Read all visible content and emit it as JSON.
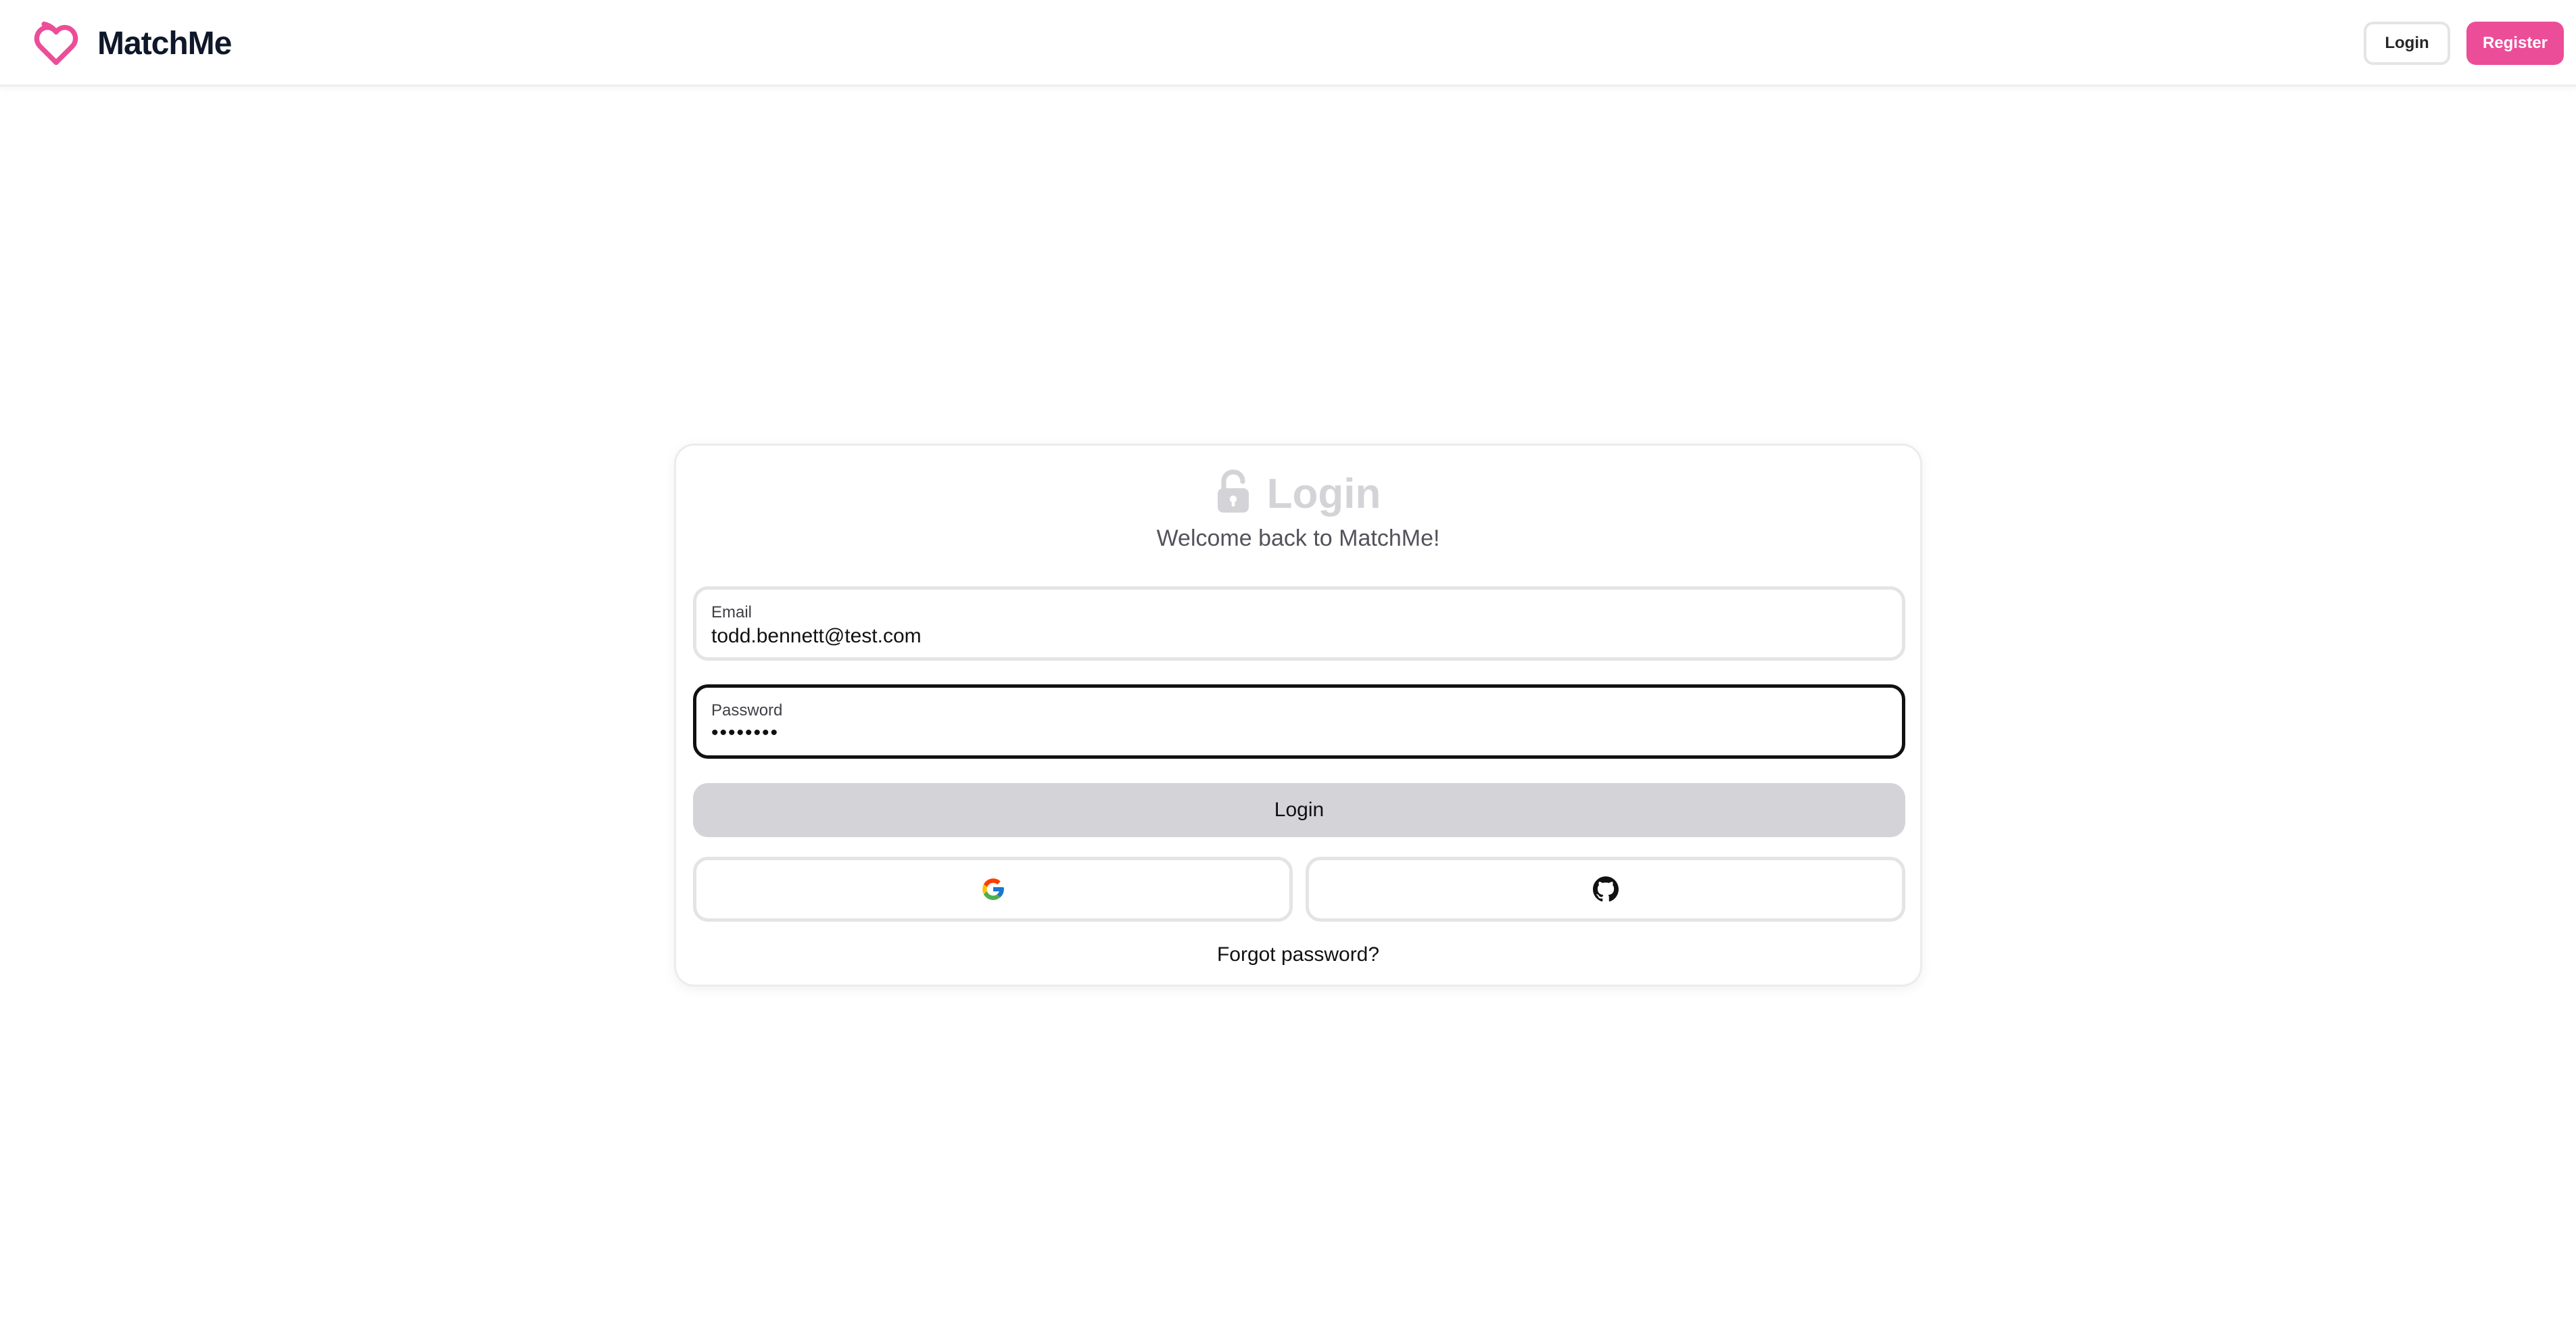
{
  "navbar": {
    "brand_name": "MatchMe",
    "login_label": "Login",
    "register_label": "Register"
  },
  "colors": {
    "accent": "#ec4d98",
    "title_muted": "#d4d4d8",
    "focus_border": "#111111"
  },
  "card": {
    "title": "Login",
    "subtitle": "Welcome back to MatchMe!",
    "icon": "lock-open-icon",
    "email": {
      "label": "Email",
      "value": "todd.bennett@test.com"
    },
    "password": {
      "label": "Password",
      "value": "••••••••"
    },
    "login_button": "Login",
    "social": [
      {
        "icon": "google-icon"
      },
      {
        "icon": "github-icon"
      }
    ],
    "forgot_password": "Forgot password?"
  }
}
